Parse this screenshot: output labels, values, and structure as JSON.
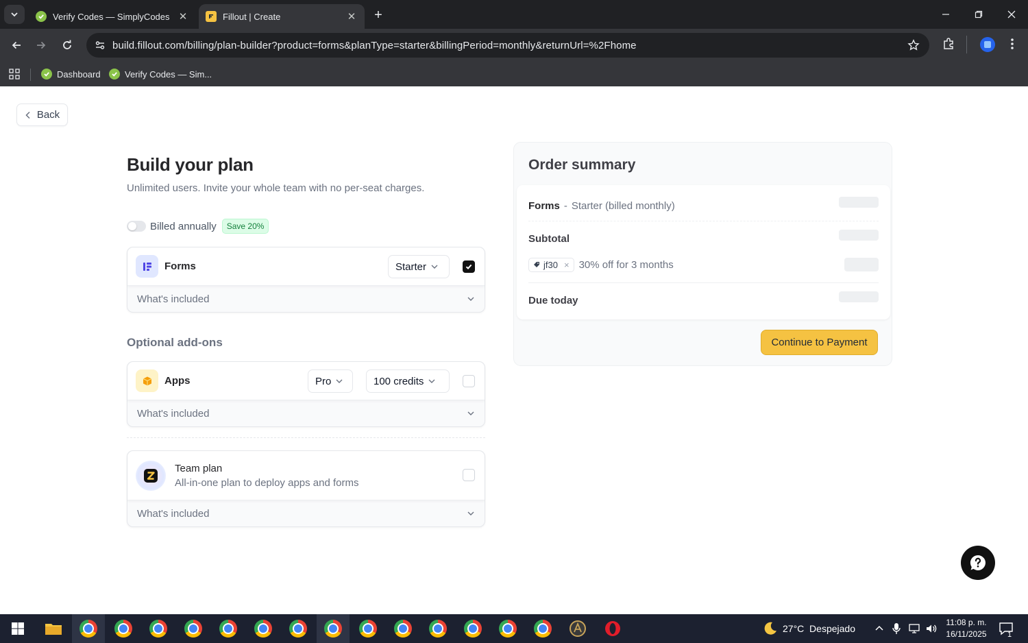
{
  "browser": {
    "tabs": [
      {
        "title": "Verify Codes — SimplyCodes",
        "active": false
      },
      {
        "title": "Fillout | Create",
        "active": true
      }
    ],
    "url": "build.fillout.com/billing/plan-builder?product=forms&planType=starter&billingPeriod=monthly&returnUrl=%2Fhome",
    "bookmarks": [
      {
        "label": "Dashboard"
      },
      {
        "label": "Verify Codes — Sim..."
      }
    ]
  },
  "page": {
    "back_label": "Back",
    "title": "Build your plan",
    "subtitle": "Unlimited users. Invite your whole team with no per-seat charges.",
    "billing": {
      "label": "Billed annually",
      "badge": "Save 20%",
      "annual_enabled": false
    },
    "forms_card": {
      "name": "Forms",
      "plan": "Starter",
      "checked": true,
      "included_label": "What's included"
    },
    "addons_title": "Optional add-ons",
    "apps_card": {
      "name": "Apps",
      "plan": "Pro",
      "credits": "100 credits",
      "checked": false,
      "included_label": "What's included"
    },
    "team_card": {
      "title": "Team plan",
      "subtitle": "All-in-one plan to deploy apps and forms",
      "checked": false,
      "included_label": "What's included"
    }
  },
  "summary": {
    "title": "Order summary",
    "line_product": "Forms",
    "line_detail": "Starter (billed monthly)",
    "subtotal_label": "Subtotal",
    "coupon_code": "jf30",
    "coupon_text": "30% off for 3 months",
    "due_label": "Due today",
    "continue_label": "Continue to Payment"
  },
  "taskbar": {
    "weather": "27°C  Despejado",
    "time": "11:08 p. m.",
    "date": "16/11/2025",
    "notifications": "1"
  },
  "colors": {
    "accent_button": "#f5c242",
    "save_badge_bg": "#dcfce7",
    "save_badge_text": "#15803d"
  }
}
